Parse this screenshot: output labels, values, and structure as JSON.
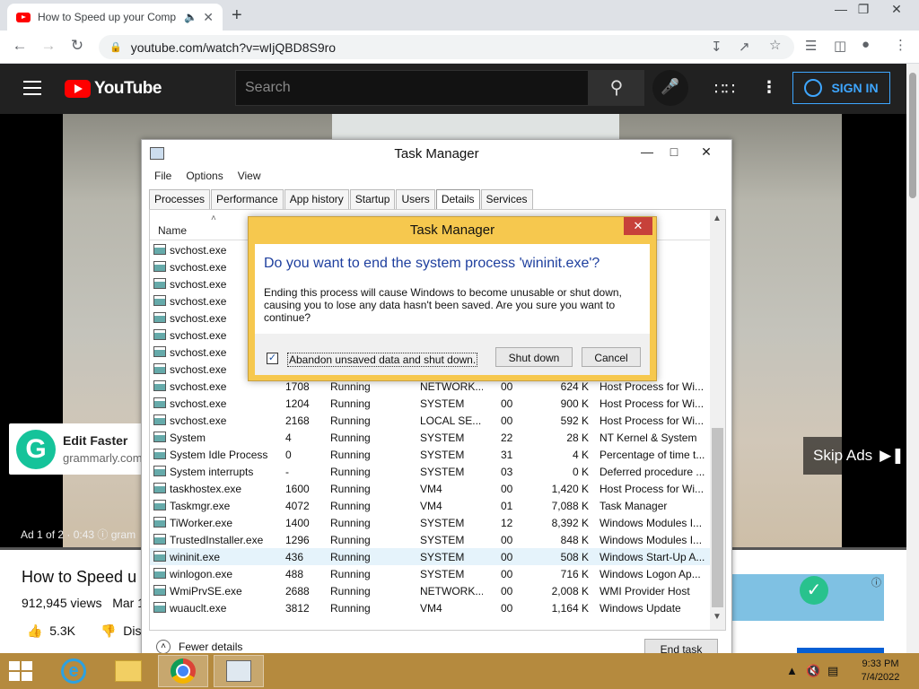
{
  "browser": {
    "tab_title": "How to Speed up your Comp",
    "url": "youtube.com/watch?v=wIjQBD8S9ro"
  },
  "youtube": {
    "logo_text": "YouTube",
    "search_placeholder": "Search",
    "signin_label": "SIGN IN",
    "ad": {
      "grammarly_title": "Edit Faster",
      "grammarly_domain": "grammarly.com",
      "skip_label": "Skip Ads",
      "ad_counter": "Ad 1 of 2 · 0:43",
      "ad_source": "gram"
    },
    "video_title": "How to Speed u",
    "views": "912,945 views",
    "date": "Mar 1",
    "likes": "5.3K",
    "dislike_label": "Dis"
  },
  "task_manager": {
    "title": "Task Manager",
    "menu": [
      "File",
      "Options",
      "View"
    ],
    "tabs": [
      "Processes",
      "Performance",
      "App history",
      "Startup",
      "Users",
      "Details",
      "Services"
    ],
    "active_tab": "Details",
    "column_name": "Name",
    "rows": [
      {
        "name": "svchost.exe",
        "pid": "",
        "status": "",
        "user": "",
        "cpu": "",
        "mem": "",
        "desc": "s for Wi..."
      },
      {
        "name": "svchost.exe",
        "pid": "",
        "status": "",
        "user": "",
        "cpu": "",
        "mem": "",
        "desc": "s for Wi..."
      },
      {
        "name": "svchost.exe",
        "pid": "",
        "status": "",
        "user": "",
        "cpu": "",
        "mem": "",
        "desc": "s for Wi..."
      },
      {
        "name": "svchost.exe",
        "pid": "",
        "status": "",
        "user": "",
        "cpu": "",
        "mem": "",
        "desc": "s for Wi..."
      },
      {
        "name": "svchost.exe",
        "pid": "",
        "status": "",
        "user": "",
        "cpu": "",
        "mem": "",
        "desc": "s for Wi..."
      },
      {
        "name": "svchost.exe",
        "pid": "",
        "status": "",
        "user": "",
        "cpu": "",
        "mem": "",
        "desc": "s for Wi..."
      },
      {
        "name": "svchost.exe",
        "pid": "",
        "status": "",
        "user": "",
        "cpu": "",
        "mem": "",
        "desc": "s for Wi..."
      },
      {
        "name": "svchost.exe",
        "pid": "",
        "status": "",
        "user": "",
        "cpu": "",
        "mem": "",
        "desc": "s for Wi..."
      },
      {
        "name": "svchost.exe",
        "pid": "1708",
        "status": "Running",
        "user": "NETWORK...",
        "cpu": "00",
        "mem": "624 K",
        "desc": "Host Process for Wi..."
      },
      {
        "name": "svchost.exe",
        "pid": "1204",
        "status": "Running",
        "user": "SYSTEM",
        "cpu": "00",
        "mem": "900 K",
        "desc": "Host Process for Wi..."
      },
      {
        "name": "svchost.exe",
        "pid": "2168",
        "status": "Running",
        "user": "LOCAL SE...",
        "cpu": "00",
        "mem": "592 K",
        "desc": "Host Process for Wi..."
      },
      {
        "name": "System",
        "pid": "4",
        "status": "Running",
        "user": "SYSTEM",
        "cpu": "22",
        "mem": "28 K",
        "desc": "NT Kernel & System"
      },
      {
        "name": "System Idle Process",
        "pid": "0",
        "status": "Running",
        "user": "SYSTEM",
        "cpu": "31",
        "mem": "4 K",
        "desc": "Percentage of time t..."
      },
      {
        "name": "System interrupts",
        "pid": "-",
        "status": "Running",
        "user": "SYSTEM",
        "cpu": "03",
        "mem": "0 K",
        "desc": "Deferred procedure ..."
      },
      {
        "name": "taskhostex.exe",
        "pid": "1600",
        "status": "Running",
        "user": "VM4",
        "cpu": "00",
        "mem": "1,420 K",
        "desc": "Host Process for Wi..."
      },
      {
        "name": "Taskmgr.exe",
        "pid": "4072",
        "status": "Running",
        "user": "VM4",
        "cpu": "01",
        "mem": "7,088 K",
        "desc": "Task Manager"
      },
      {
        "name": "TiWorker.exe",
        "pid": "1400",
        "status": "Running",
        "user": "SYSTEM",
        "cpu": "12",
        "mem": "8,392 K",
        "desc": "Windows Modules I..."
      },
      {
        "name": "TrustedInstaller.exe",
        "pid": "1296",
        "status": "Running",
        "user": "SYSTEM",
        "cpu": "00",
        "mem": "848 K",
        "desc": "Windows Modules I..."
      },
      {
        "name": "wininit.exe",
        "pid": "436",
        "status": "Running",
        "user": "SYSTEM",
        "cpu": "00",
        "mem": "508 K",
        "desc": "Windows Start-Up A..."
      },
      {
        "name": "winlogon.exe",
        "pid": "488",
        "status": "Running",
        "user": "SYSTEM",
        "cpu": "00",
        "mem": "716 K",
        "desc": "Windows Logon Ap..."
      },
      {
        "name": "WmiPrvSE.exe",
        "pid": "2688",
        "status": "Running",
        "user": "NETWORK...",
        "cpu": "00",
        "mem": "2,008 K",
        "desc": "WMI Provider Host"
      },
      {
        "name": "wuauclt.exe",
        "pid": "3812",
        "status": "Running",
        "user": "VM4",
        "cpu": "00",
        "mem": "1,164 K",
        "desc": "Windows Update"
      }
    ],
    "selected_row": "wininit.exe",
    "fewer_details": "Fewer details",
    "end_task": "End task"
  },
  "dialog": {
    "title": "Task Manager",
    "question": "Do you want to end the system process 'wininit.exe'?",
    "message": "Ending this process will cause Windows to become unusable or shut down, causing you to lose any data hasn't been saved. Are you sure you want to continue?",
    "checkbox_label": "Abandon unsaved data and shut down.",
    "checkbox_checked": true,
    "shutdown_label": "Shut down",
    "cancel_label": "Cancel"
  },
  "taskbar": {
    "time": "9:33 PM",
    "date": "7/4/2022"
  },
  "icons": [
    "youtube-favicon",
    "audio-icon",
    "close-icon",
    "new-tab-icon",
    "back-icon",
    "forward-icon",
    "reload-icon",
    "lock-icon",
    "install-icon",
    "share-icon",
    "star-icon",
    "reading-list-icon",
    "sidebar-icon",
    "profile-icon",
    "menu-icon",
    "search-icon",
    "mic-icon",
    "apps-icon",
    "more-icon",
    "user-icon",
    "windows-logo-icon",
    "ie-icon",
    "folder-icon",
    "chrome-icon",
    "task-manager-icon",
    "network-icon",
    "volume-muted-icon"
  ]
}
